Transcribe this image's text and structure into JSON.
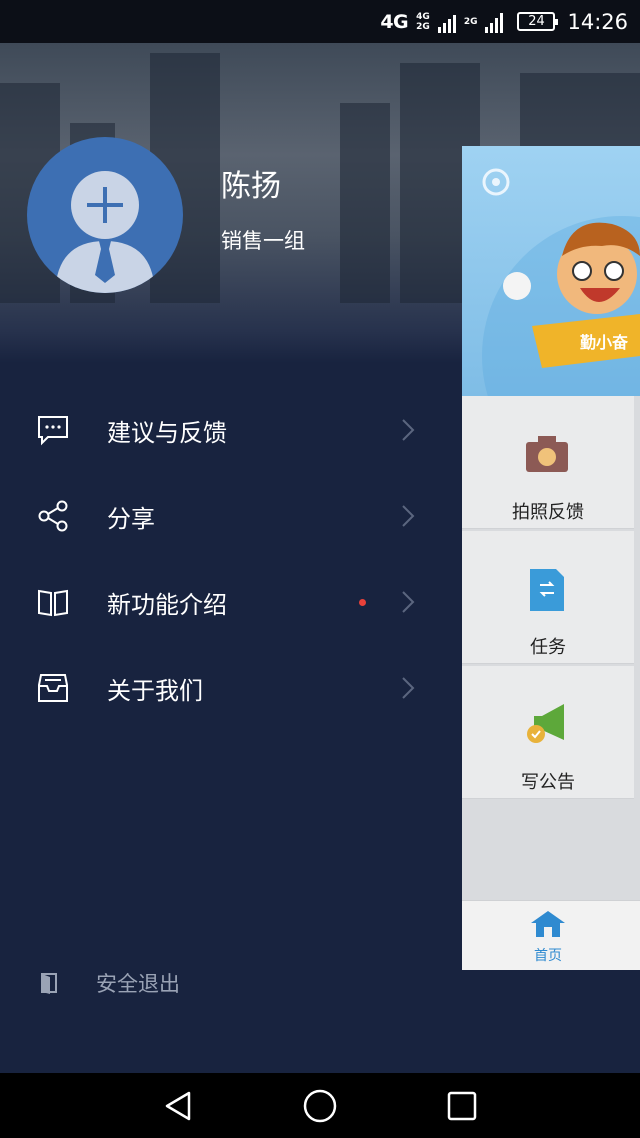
{
  "status_bar": {
    "network_main": "4G",
    "network_small_top": "4G",
    "network_small_bottom": "2G",
    "network_third": "2G",
    "battery": "24",
    "time": "14:26"
  },
  "profile": {
    "name": "陈扬",
    "group": "销售一组"
  },
  "menu": {
    "items": [
      {
        "label": "建议与反馈",
        "icon": "feedback-icon"
      },
      {
        "label": "分享",
        "icon": "share-icon"
      },
      {
        "label": "新功能介绍",
        "icon": "book-icon",
        "badge_dot": true
      },
      {
        "label": "关于我们",
        "icon": "inbox-icon"
      }
    ]
  },
  "logout": {
    "label": "安全退出"
  },
  "main_pane": {
    "tiles": [
      {
        "label": "拍照反馈",
        "icon": "camera-icon"
      },
      {
        "label": "任务",
        "icon": "task-document-icon"
      },
      {
        "label": "写公告",
        "icon": "announcement-icon"
      }
    ],
    "tabbar": {
      "home_label": "首页"
    },
    "banner_text": "勤小奋"
  },
  "colors": {
    "drawer_bg": "#18233f",
    "avatar_bg": "#3d6fb3",
    "dot": "#e8413a",
    "tab_active": "#2f8ad0"
  }
}
